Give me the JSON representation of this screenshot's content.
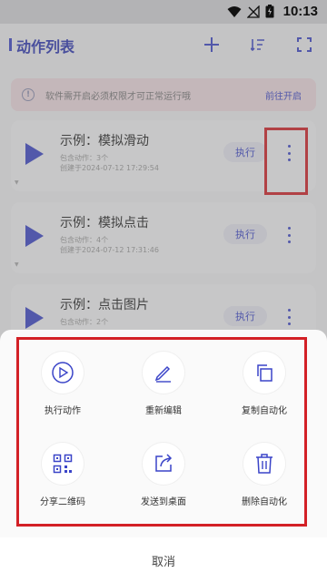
{
  "status_bar": {
    "time": "10:13"
  },
  "app_bar": {
    "title": "动作列表",
    "icons": [
      "plus-icon",
      "sort-icon",
      "scan-icon"
    ]
  },
  "banner": {
    "text": "软件需开启必须权限才可正常运行哦",
    "link": "前往开启"
  },
  "cards": [
    {
      "title": "示例：模拟滑动",
      "line1": "包含动作：3个",
      "line2": "创建于2024-07-12 17:29:54",
      "run": "执行"
    },
    {
      "title": "示例：模拟点击",
      "line1": "包含动作：4个",
      "line2": "创建于2024-07-12 17:31:46",
      "run": "执行"
    },
    {
      "title": "示例：点击图片",
      "line1": "包含动作：2个",
      "line2": "",
      "run": "执行"
    }
  ],
  "sheet": {
    "actions": [
      {
        "label": "执行动作",
        "icon": "play-circle-icon"
      },
      {
        "label": "重新编辑",
        "icon": "pencil-icon"
      },
      {
        "label": "复制自动化",
        "icon": "copy-icon"
      },
      {
        "label": "分享二维码",
        "icon": "qr-code-icon"
      },
      {
        "label": "发送到桌面",
        "icon": "send-to-desktop-icon"
      },
      {
        "label": "删除自动化",
        "icon": "trash-icon"
      }
    ],
    "cancel": "取消"
  },
  "colors": {
    "accent": "#3a44c8",
    "highlight": "#d32026"
  }
}
